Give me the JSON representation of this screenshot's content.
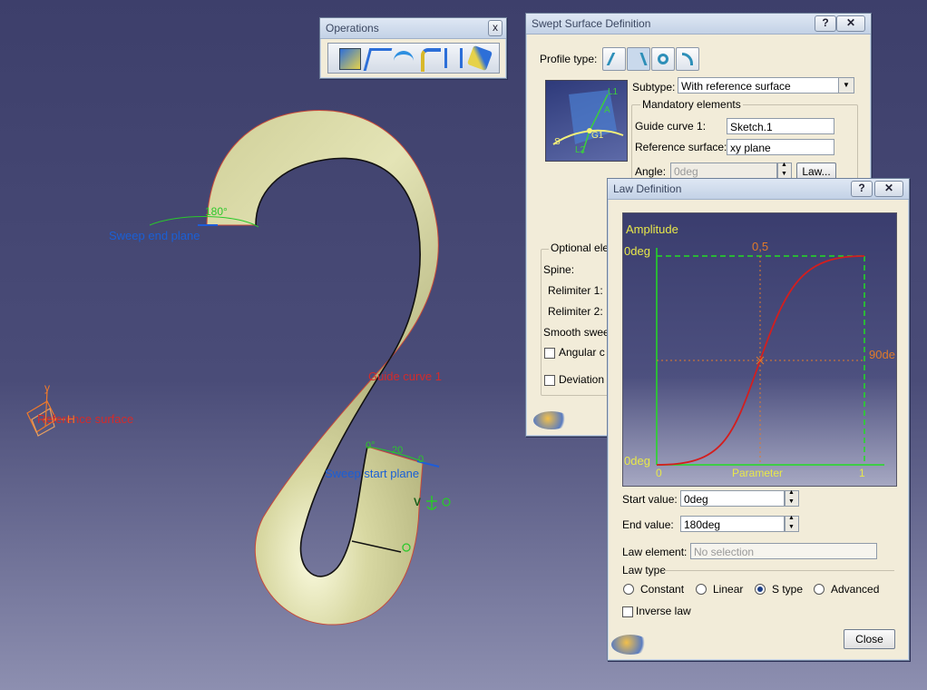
{
  "colors": {
    "background_top": "#3d3f6b",
    "surface_fill": "#d7d7a0",
    "guide_color": "#d22b2b",
    "plane_label": "#1a5fd6",
    "angle_green": "#28c828",
    "graph_axis": "#22dd22",
    "graph_curve": "#d41e1e",
    "graph_text": "#e8e84a"
  },
  "viewport": {
    "sweep_end_plane": "Sweep end plane",
    "angle_label": "180°",
    "guide_curve": "Guide curve 1",
    "sweep_start_plane": "Sweep start plane",
    "reference_surface": "Reference surface",
    "axis_y": "y",
    "axis_h": "H",
    "start_tick_0": "0°",
    "start_tick_20": "20",
    "start_tick_end": "0",
    "manip_v": "V"
  },
  "operations": {
    "title": "Operations",
    "close": "x",
    "icons": [
      "fillet-icon",
      "translate-icon",
      "extrapolate-icon",
      "trim-icon",
      "split-icon",
      "boundary-icon"
    ]
  },
  "swept": {
    "title": "Swept Surface Definition",
    "help": "?",
    "close": "✕",
    "profile_type_label": "Profile type:",
    "profile_icons": [
      "explicit-profile-icon",
      "line-profile-icon",
      "circle-profile-icon",
      "conic-profile-icon"
    ],
    "subtype_label": "Subtype:",
    "subtype_value": "With reference surface",
    "mandatory_label": "Mandatory elements",
    "guide_curve_label": "Guide curve 1:",
    "guide_curve_value": "Sketch.1",
    "reference_surface_label": "Reference surface:",
    "reference_surface_value": "xy plane",
    "angle_label": "Angle:",
    "angle_value": "0deg",
    "law_button": "Law...",
    "optional_label": "Optional ele",
    "spine_label": "Spine:",
    "relimiter1_label": "Relimiter 1:",
    "relimiter2_label": "Relimiter 2:",
    "smooth_label": "Smooth swee",
    "angular_label": "Angular c",
    "deviation_label": "Deviation",
    "preview_labels": {
      "l1": "L1",
      "a": "A",
      "g1": "G1",
      "s": "S",
      "l2": "L2"
    }
  },
  "law": {
    "title": "Law Definition",
    "help": "?",
    "close": "✕",
    "graph": {
      "amplitude": "Amplitude",
      "top_value": "0deg",
      "bottom_value": "0deg",
      "right_value": "90de",
      "mid_top": "0,5",
      "x0": "0",
      "x_label": "Parameter",
      "x1": "1"
    },
    "start_value_label": "Start value:",
    "start_value": "0deg",
    "end_value_label": "End value:",
    "end_value": "180deg",
    "law_element_label": "Law element:",
    "law_element_placeholder": "No selection",
    "law_type_label": "Law type",
    "types": [
      "Constant",
      "Linear",
      "S type",
      "Advanced"
    ],
    "selected_type": "S type",
    "inverse_label": "Inverse law",
    "close_button": "Close"
  }
}
